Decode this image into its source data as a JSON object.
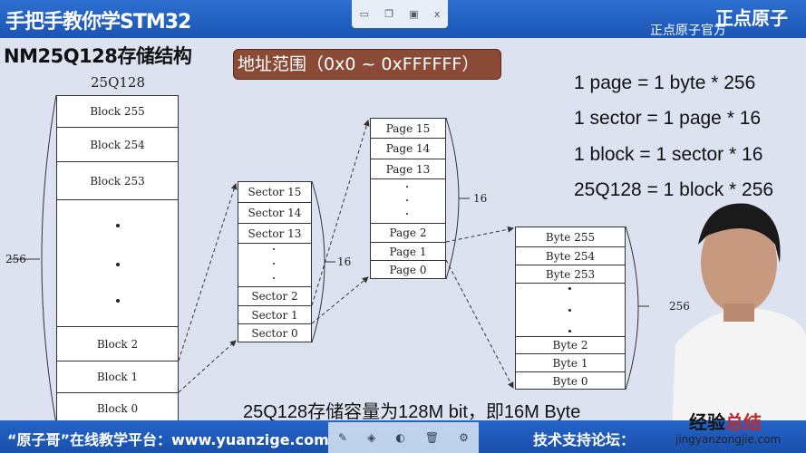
{
  "header": {
    "course_title": "手把手教你学STM32",
    "brand": "正点原子",
    "brand_sub": "正点原子官方",
    "toolbar_icons": [
      "minimize-icon",
      "copy-icon",
      "save-icon",
      "close-icon"
    ],
    "close_label": "x"
  },
  "slide": {
    "title": "NM25Q128存储结构",
    "address_range": "地址范围（0x0 ~ 0xFFFFFF）",
    "chip_label": "25Q128",
    "blocks": {
      "top": [
        "Block 255",
        "Block 254",
        "Block 253"
      ],
      "bottom": [
        "Block 2",
        "Block 1",
        "Block 0"
      ],
      "count_label": "256"
    },
    "sectors": {
      "top": [
        "Sector 15",
        "Sector 14",
        "Sector 13"
      ],
      "bottom": [
        "Sector 2",
        "Sector 1",
        "Sector 0"
      ],
      "count_label": "16"
    },
    "pages": {
      "top": [
        "Page 15",
        "Page 14",
        "Page 13"
      ],
      "bottom": [
        "Page 2",
        "Page 1",
        "Page 0"
      ],
      "count_label": "16"
    },
    "bytes": {
      "top": [
        "Byte 255",
        "Byte 254",
        "Byte 253"
      ],
      "bottom": [
        "Byte 2",
        "Byte 1",
        "Byte 0"
      ],
      "count_label": "256"
    },
    "equations": [
      "1 page = 1 byte * 256",
      "1 sector = 1 page * 16",
      "1 block = 1 sector * 16",
      "25Q128 = 1 block * 256"
    ],
    "caption": "25Q128存储容量为128M bit，即16M Byte"
  },
  "footer": {
    "platform": "“原子哥”在线教学平台：www.yuanzige.com",
    "forum": "技术支持论坛：",
    "toolbar_icons": [
      "pen-icon",
      "eraser-icon",
      "color-icon",
      "trash-icon",
      "settings-icon"
    ]
  },
  "watermark": {
    "text_a": "经验",
    "text_b": "总结",
    "url": "jingyanzongjie.com"
  }
}
